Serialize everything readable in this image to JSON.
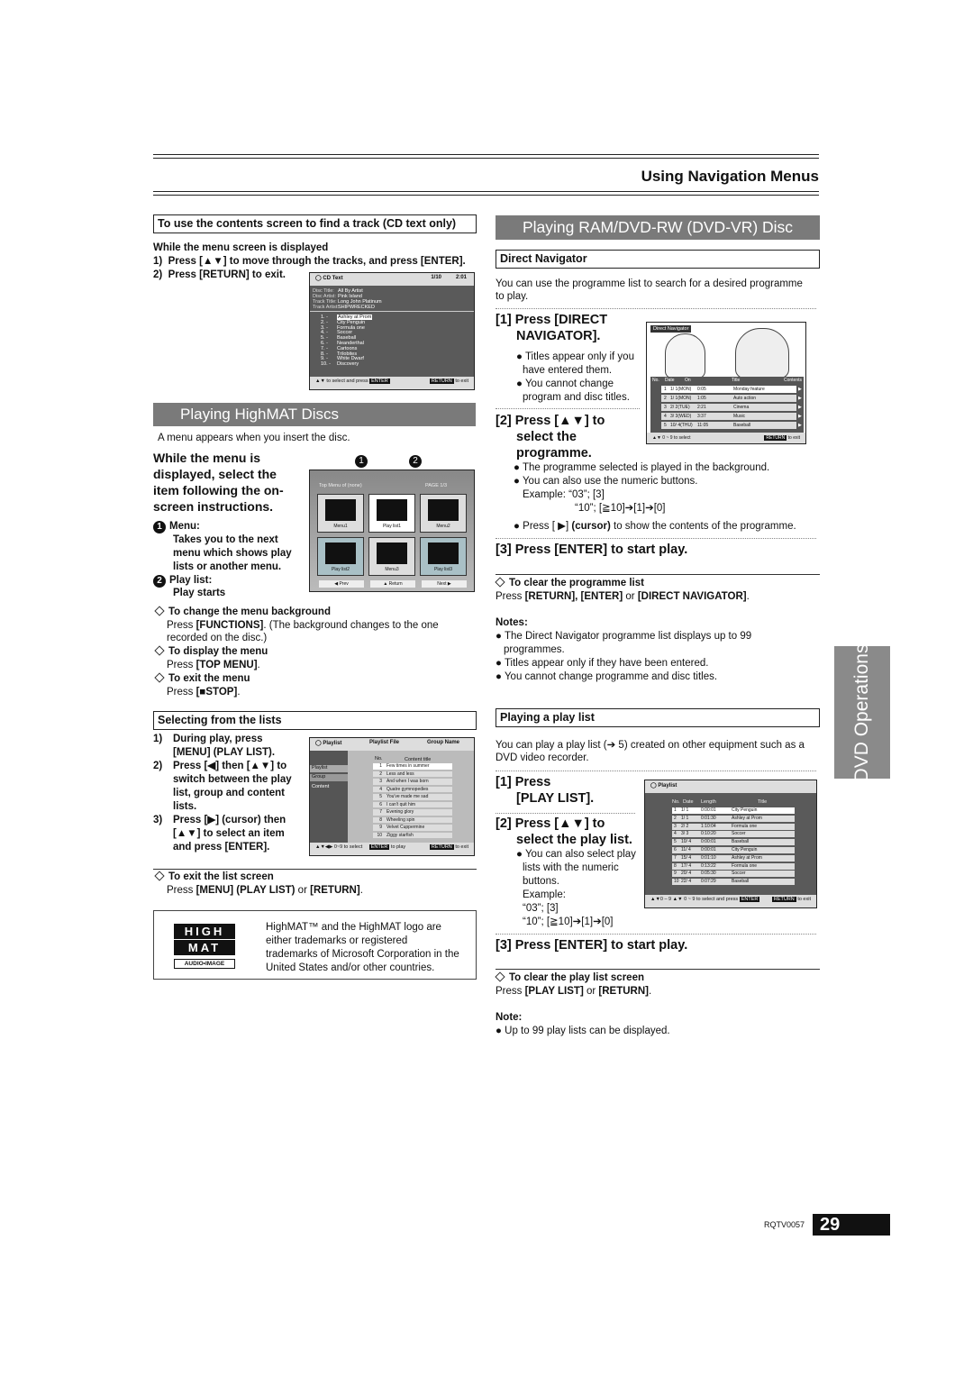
{
  "header": {
    "title": "Using Navigation Menus"
  },
  "cd": {
    "title": "To use the contents screen to find a track (CD text only)",
    "while": "While the menu screen is displayed",
    "step1_num": "1)",
    "step1": "Press [▲▼] to move through the tracks, and press [ENTER].",
    "step2_num": "2)",
    "step2": "Press [RETURN] to exit.",
    "screen": {
      "title": "CD Text",
      "track": "1/10",
      "time": "2:01",
      "info": [
        {
          "label": "Disc Title:",
          "value": "All By Artist"
        },
        {
          "label": "Disc Artist:",
          "value": "Pink Island"
        },
        {
          "label": "Track Title:",
          "value": "Long John Platinum"
        },
        {
          "label": "Track Artist:",
          "value": "SHIPWRECKED"
        }
      ],
      "tracks": [
        "Ashley at Prom",
        "City Penguin",
        "Formula one",
        "Soccer",
        "Baseball",
        "Neanderthal",
        "Cartoons",
        "Trilobites",
        "White Dwarf",
        "Discovery"
      ],
      "footer": "▲▼ to select and press",
      "enter": "ENTER",
      "return": "RETURN",
      "exit": "to exit"
    }
  },
  "highmat": {
    "heading": "Playing HighMAT Discs",
    "intro": "A menu appears when you insert the disc.",
    "instruction": [
      "While the menu is",
      "displayed, select the",
      "item following the on-",
      "screen instructions."
    ],
    "callout1": "1",
    "callout2": "2",
    "menu_label": "Menu:",
    "menu_desc": [
      "Takes you to the next",
      "menu which shows play",
      "lists or another menu."
    ],
    "playlist_label": "Play list:",
    "playlist_desc": "Play starts",
    "screen": {
      "top_menu": "Top Menu of (none)",
      "page": "PAGE 1/3",
      "items": [
        "Menu1",
        "Play list1",
        "Menu2",
        "Play list2",
        "Menu3",
        "Play list3"
      ],
      "prev": "◀ Prev",
      "return": "▲ Return",
      "next": "Next ▶"
    },
    "tips": [
      {
        "title": "To change the menu background",
        "pre": "Press ",
        "key": "[FUNCTIONS]",
        "post": ". (The background changes to the one",
        "line2": "recorded on the disc.)"
      },
      {
        "title": "To display the menu",
        "pre": "Press ",
        "key": "[TOP MENU]",
        "post": "."
      },
      {
        "title": "To exit the menu",
        "pre": "Press ",
        "key": "[■STOP]",
        "post": "."
      }
    ]
  },
  "lists": {
    "title": "Selecting from the lists",
    "steps": [
      {
        "num": "1)",
        "lines": [
          "During play, press",
          "[MENU] (PLAY LIST)."
        ]
      },
      {
        "num": "2)",
        "lines": [
          "Press [◀] then [▲▼] to",
          "switch between the play",
          "list, group and content",
          "lists."
        ]
      },
      {
        "num": "3)",
        "lines": [
          "Press [▶] (cursor) then",
          "[▲▼] to select an item",
          "and press [ENTER]."
        ]
      }
    ],
    "screen": {
      "title": "Playlist",
      "col2": "Playlist File",
      "col3": "Group Name",
      "side": [
        "Playlist",
        "Group",
        "Content"
      ],
      "no": "No.",
      "content_title": "Content title",
      "items": [
        "Few times in summer",
        "Less and less",
        "And when I was born",
        "Quatre gymnopedies",
        "You've made me sad",
        "I can't quit him",
        "Evening glory",
        "Wheeling spin",
        "Velvet Cuppermine",
        "Ziggy starfish"
      ],
      "f1": "to select",
      "enter": "ENTER",
      "f2": "to play",
      "return": "RETURN",
      "f3": "to exit"
    },
    "exit_title": "To exit the list screen",
    "exit_pre": "Press ",
    "exit_k1": "[MENU] (PLAY LIST)",
    "exit_mid": " or ",
    "exit_k2": "[RETURN]",
    "exit_post": "."
  },
  "trademark": {
    "logo_top": "HIGH",
    "logo_mid": "MAT",
    "logo_bottom": "AUDIO•IMAGE",
    "text": [
      "HighMAT™ and the HighMAT logo are",
      "either trademarks or registered",
      "trademarks of Microsoft Corporation in the",
      "United States and/or other countries."
    ]
  },
  "ram": {
    "heading": "Playing RAM/DVD-RW (DVD-VR) Disc",
    "dn_title": "Direct Navigator",
    "dn_intro": [
      "You can use the programme list to search for a desired programme",
      "to play."
    ],
    "s1": [
      "[1] Press [DIRECT",
      "NAVIGATOR]."
    ],
    "s1_bullets": [
      "Titles appear only if you",
      "have entered them.",
      "You cannot change",
      "program and disc titles."
    ],
    "s2": [
      "[2] Press [▲▼] to",
      "select the",
      "programme."
    ],
    "s2_bullets": [
      "The programme selected is played in the background.",
      "You can also use the numeric buttons."
    ],
    "ex1": "Example:  “03”; [3]",
    "ex2": "“10”; [≧10]➔[1]➔[0]",
    "cursor_pre": "Press [ ▶] ",
    "cursor_b": "(cursor)",
    "cursor_post": " to show the contents of the programme.",
    "s3": "[3] Press [ENTER] to start play.",
    "clear_title": "To clear the programme list",
    "clear_pre": "Press ",
    "clear_k": "[RETURN], [ENTER]",
    "clear_mid": " or ",
    "clear_k2": "[DIRECT NAVIGATOR]",
    "clear_post": ".",
    "notes_title": "Notes:",
    "notes": [
      "The Direct Navigator programme list displays up to 99",
      "programmes.",
      "Titles appear only if they have been entered.",
      "You cannot change programme and disc titles."
    ],
    "screen": {
      "title": "Direct Navigator",
      "cols": [
        "No.",
        "Date",
        "On",
        "Title",
        "Contents"
      ],
      "rows": [
        [
          "1",
          " 1/ 1(MON)",
          "0:05",
          "Monday feature"
        ],
        [
          "2",
          " 1/ 1(MON)",
          "1:05",
          "Auto action"
        ],
        [
          "3",
          " 2/ 2(TUE)",
          "2:21",
          "Cinema"
        ],
        [
          "4",
          " 3/ 3(WED)",
          "3:37",
          "Music"
        ],
        [
          "5",
          "10/ 4(THU)",
          "11:05",
          "Baseball"
        ]
      ],
      "f1": "▲▼ 0 ~ 9 to select",
      "return": "RETURN",
      "f2": "to exit"
    }
  },
  "pl": {
    "title": "Playing a play list",
    "intro": [
      "You can play a play list (➔ 5) created on other equipment such as a",
      "DVD video recorder."
    ],
    "s1": [
      "[1] Press",
      "[PLAY LIST]."
    ],
    "s2": [
      "[2] Press [▲▼] to",
      "select the play list."
    ],
    "bullets": [
      "You can also select play",
      "lists with the numeric",
      "buttons."
    ],
    "ex": [
      "Example:",
      "“03”; [3]",
      "“10”; [≧10]➔[1]➔[0]"
    ],
    "s3": "[3] Press [ENTER] to start play.",
    "clear_title": "To clear the play list screen",
    "clear_pre": "Press ",
    "clear_k": "[PLAY LIST]",
    "clear_mid": " or ",
    "clear_k2": "[RETURN]",
    "clear_post": ".",
    "note_title": "Note:",
    "note": "Up to 99 play lists can be displayed.",
    "screen": {
      "title": "Playlist",
      "cols": [
        "No.",
        "Date",
        "Length",
        "Title"
      ],
      "rows": [
        [
          "1",
          " 1/ 1",
          "0:00:01",
          "City Penguin"
        ],
        [
          "2",
          " 1/ 1",
          "0:01:30",
          "Ashley at Prom"
        ],
        [
          "3",
          " 2/ 2",
          "1:10:04",
          "Formula one"
        ],
        [
          "4",
          " 3/ 3",
          "0:10:20",
          "Soccer"
        ],
        [
          "5",
          "10/ 4",
          "0:00:01",
          "Baseball"
        ],
        [
          "6",
          "11/ 4",
          "0:00:01",
          "City Penguin"
        ],
        [
          "7",
          "15/ 4",
          "0:01:10",
          "Ashley at Prom"
        ],
        [
          "8",
          "17/ 4",
          "0:13:22",
          "Formula one"
        ],
        [
          "9",
          "20/ 4",
          "0:05:30",
          "Soccer"
        ],
        [
          "10",
          "22/ 4",
          "0:07:29",
          "Baseball"
        ]
      ],
      "f1": "▲▼ 0 ~ 9 to select and press",
      "enter": "ENTER",
      "return": "RETURN",
      "f2": "to exit"
    }
  },
  "side_tab": "DVD Operations",
  "footer": {
    "code": "RQTV0057",
    "page": "29"
  }
}
